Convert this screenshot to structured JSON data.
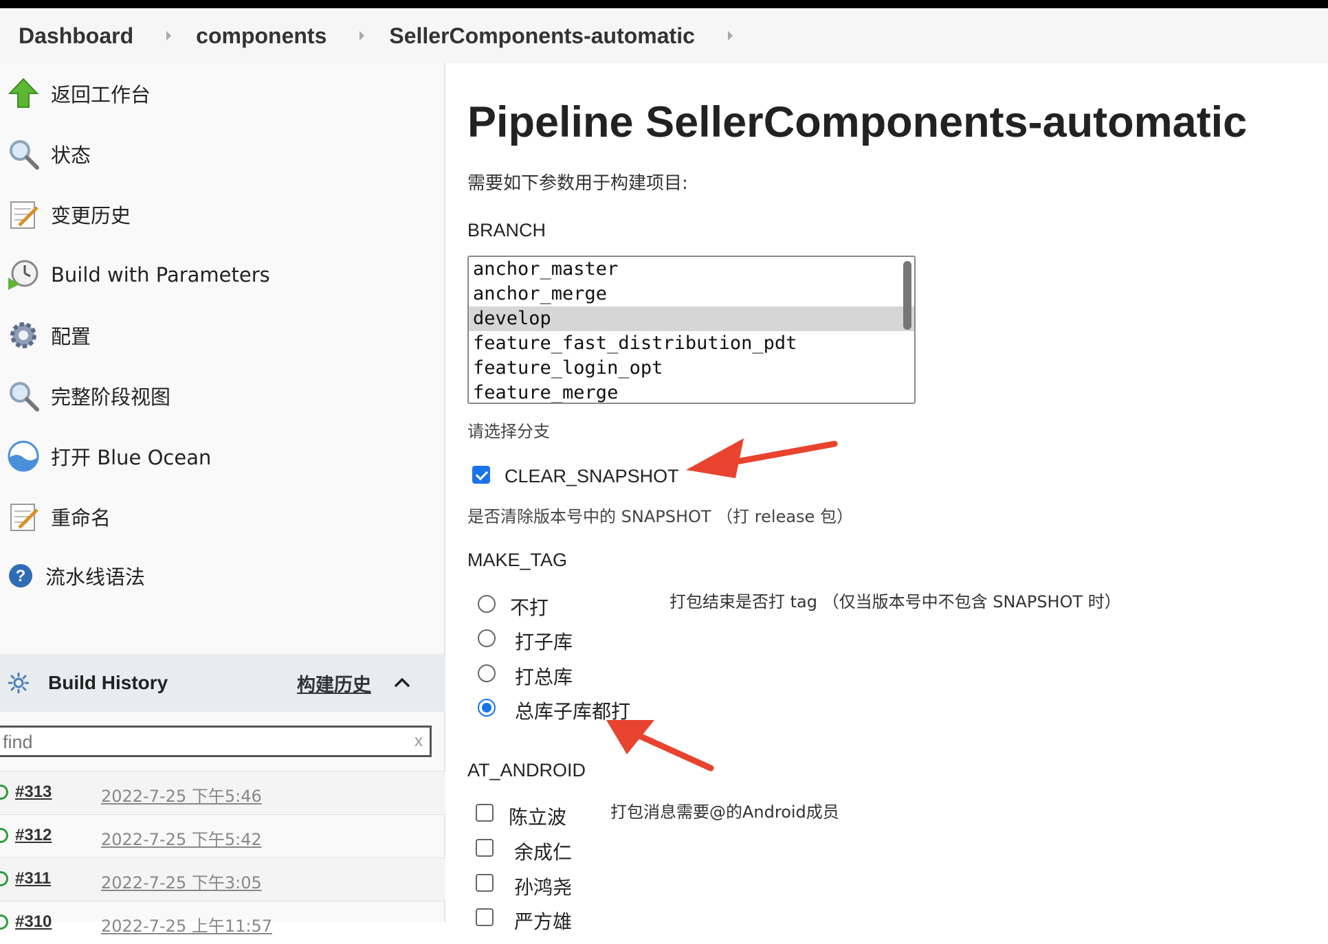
{
  "breadcrumb": [
    "Dashboard",
    "components",
    "SellerComponents-automatic"
  ],
  "sidebar": {
    "items": [
      {
        "label": "返回工作台",
        "icon": "arrow-up-icon"
      },
      {
        "label": "状态",
        "icon": "magnifier-icon"
      },
      {
        "label": "变更历史",
        "icon": "notepad-icon"
      },
      {
        "label": "Build with Parameters",
        "icon": "clock-play-icon"
      },
      {
        "label": "配置",
        "icon": "gear-icon"
      },
      {
        "label": "完整阶段视图",
        "icon": "magnifier-icon"
      },
      {
        "label": "打开 Blue Ocean",
        "icon": "blue-ocean-icon"
      },
      {
        "label": "重命名",
        "icon": "notepad-icon"
      },
      {
        "label": "流水线语法",
        "icon": "help-icon"
      }
    ]
  },
  "build_history": {
    "title": "Build History",
    "trend_link": "构建历史",
    "find_placeholder": "find",
    "clear": "x",
    "builds": [
      {
        "number": "#313",
        "date": "2022-7-25 下午5:46"
      },
      {
        "number": "#312",
        "date": "2022-7-25 下午5:42"
      },
      {
        "number": "#311",
        "date": "2022-7-25 下午3:05"
      },
      {
        "number": "#310",
        "date": "2022-7-25 上午11:57"
      }
    ]
  },
  "main": {
    "title": "Pipeline SellerComponents-automatic",
    "description": "需要如下参数用于构建项目:",
    "branch": {
      "label": "BRANCH",
      "options": [
        "anchor_master",
        "anchor_merge",
        "develop",
        "feature_fast_distribution_pdt",
        "feature_login_opt",
        "feature_merge"
      ],
      "selected": "develop",
      "hint": "请选择分支"
    },
    "clear_snapshot": {
      "label": "CLEAR_SNAPSHOT",
      "checked": true,
      "hint": "是否清除版本号中的 SNAPSHOT （打 release 包）"
    },
    "make_tag": {
      "label": "MAKE_TAG",
      "options": [
        "不打",
        "打子库",
        "打总库",
        "总库子库都打"
      ],
      "selected": "总库子库都打",
      "hint": "打包结束是否打 tag （仅当版本号中不包含 SNAPSHOT 时）"
    },
    "at_android": {
      "label": "AT_ANDROID",
      "options": [
        "陈立波",
        "余成仁",
        "孙鸿尧",
        "严方雄"
      ],
      "hint": "打包消息需要@的Android成员"
    }
  },
  "colors": {
    "accent": "#1a73e8",
    "annotation_arrow": "#e8432e",
    "success": "#2a9d3c"
  }
}
